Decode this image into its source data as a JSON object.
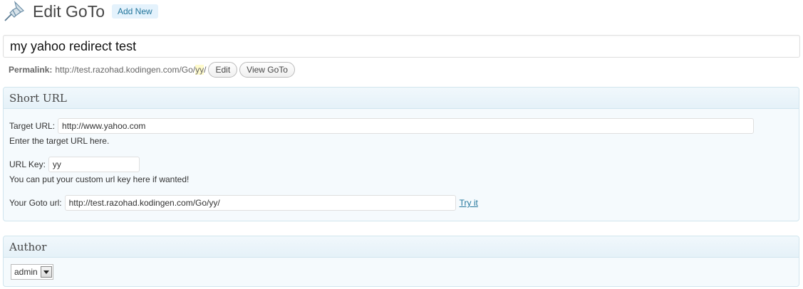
{
  "header": {
    "title": "Edit GoTo",
    "add_new_label": "Add New"
  },
  "title_field": {
    "value": "my yahoo redirect test"
  },
  "permalink": {
    "label": "Permalink:",
    "url_prefix": "http://test.razohad.kodingen.com/Go/",
    "url_key": "yy",
    "url_suffix": "/",
    "edit_label": "Edit",
    "view_label": "View GoTo"
  },
  "short_url_box": {
    "title": "Short URL",
    "target_label": "Target URL:",
    "target_value": "http://www.yahoo.com",
    "target_hint": "Enter the target URL here.",
    "key_label": "URL Key:",
    "key_value": "yy",
    "key_hint": "You can put your custom url key here if wanted!",
    "goto_label": "Your Goto url:",
    "goto_value": "http://test.razohad.kodingen.com/Go/yy/",
    "try_label": "Try it"
  },
  "author_box": {
    "title": "Author",
    "selected": "admin"
  },
  "colors": {
    "link": "#21759b",
    "box_border": "#d1e5ee",
    "box_bg": "#f5fafd"
  }
}
